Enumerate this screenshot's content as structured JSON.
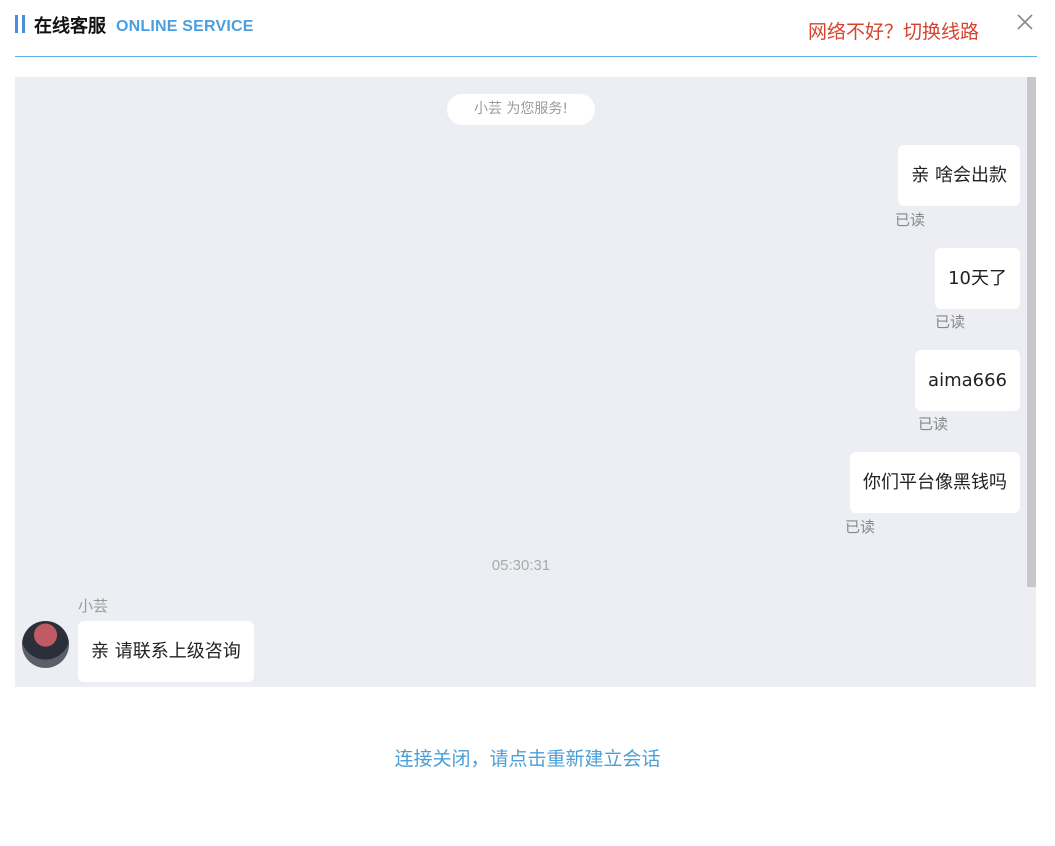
{
  "header": {
    "title_cn": "在线客服",
    "title_en": "ONLINE SERVICE",
    "switch_line": "网络不好？切换线路",
    "close_icon": "close-icon"
  },
  "chat": {
    "system_notice": "小芸 为您服务!",
    "messages": [
      {
        "text": "亲 啥会出款",
        "status": "已读"
      },
      {
        "text": "10天了",
        "status": "已读"
      },
      {
        "text": "aima666",
        "status": "已读"
      },
      {
        "text": "你们平台像黑钱吗",
        "status": "已读"
      }
    ],
    "timestamp": "05:30:31",
    "agent": {
      "name": "小芸",
      "avatar_icon": "avatar-icon",
      "message": "亲  请联系上级咨询"
    }
  },
  "footer": {
    "reconnect": "连接关闭，请点击重新建立会话"
  },
  "colors": {
    "accent_blue": "#4a9fe0",
    "warning_red": "#d8432f",
    "chat_bg": "#eceef4"
  }
}
